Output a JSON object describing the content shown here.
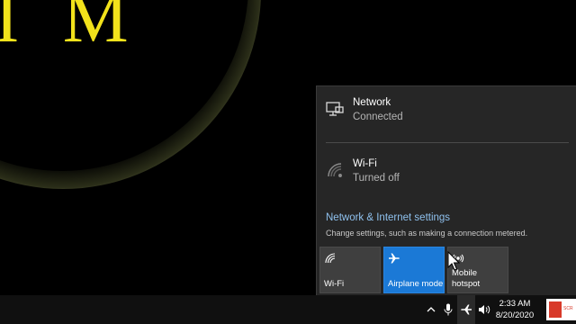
{
  "wallpaper": {
    "text": "I M"
  },
  "network_flyout": {
    "ethernet": {
      "title": "Network",
      "status": "Connected",
      "icon": "ethernet-monitor-icon"
    },
    "wifi": {
      "title": "Wi-Fi",
      "status": "Turned off",
      "icon": "wifi-off-icon"
    },
    "settings_link": "Network & Internet settings",
    "settings_desc": "Change settings, such as making a connection metered.",
    "quick_actions": [
      {
        "label": "Wi-Fi",
        "icon": "wifi-icon",
        "active": false
      },
      {
        "label": "Airplane mode",
        "icon": "airplane-icon",
        "active": true
      },
      {
        "label": "Mobile hotspot",
        "icon": "hotspot-icon",
        "active": false
      }
    ],
    "colors": {
      "panel": "#262626",
      "accent": "#1b79d6",
      "link": "#8fc1ee"
    }
  },
  "taskbar": {
    "time": "2:33 AM",
    "date": "8/20/2020",
    "tray_icons": [
      "chevron-up-icon",
      "microphone-icon",
      "airplane-icon",
      "volume-icon"
    ],
    "notification_text": "SCR"
  }
}
